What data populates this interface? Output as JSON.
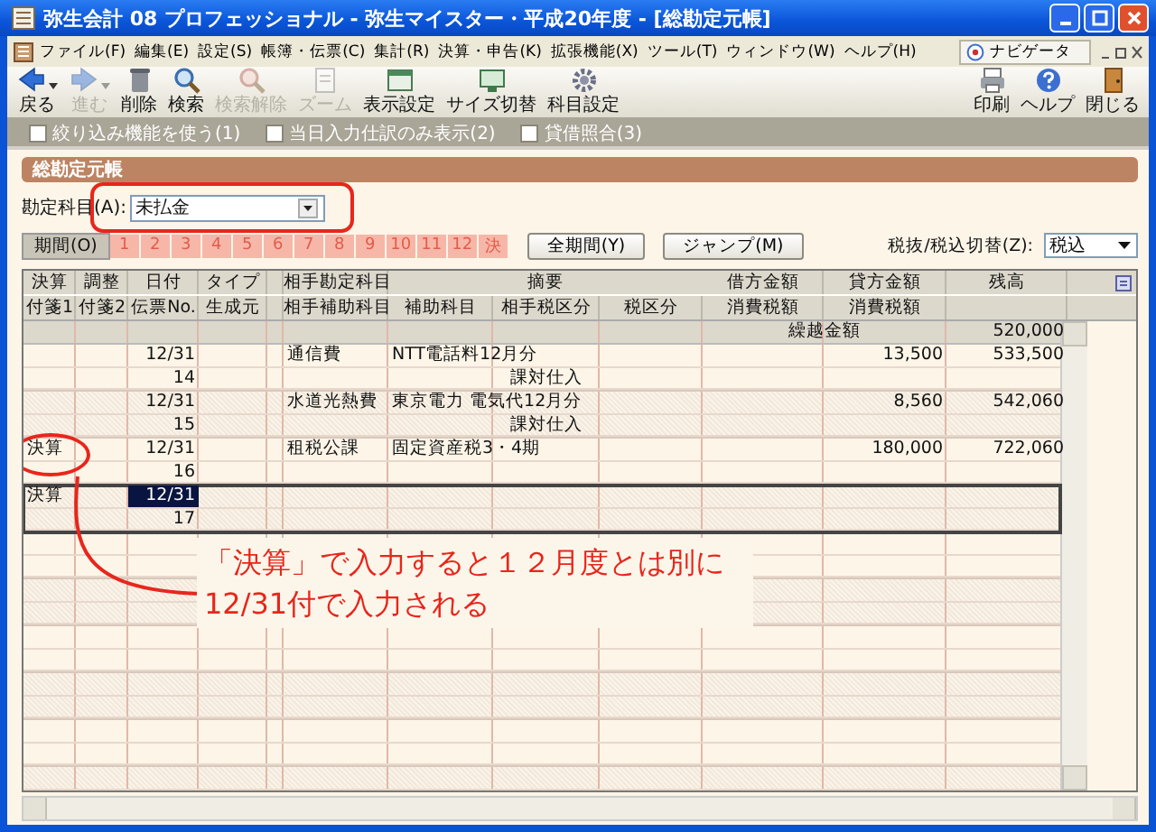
{
  "window": {
    "title": "弥生会計 08 プロフェッショナル - 弥生マイスター・平成20年度 - [総勘定元帳]"
  },
  "menu": {
    "items": [
      "ファイル(F)",
      "編集(E)",
      "設定(S)",
      "帳簿・伝票(C)",
      "集計(R)",
      "決算・申告(K)",
      "拡張機能(X)",
      "ツール(T)",
      "ウィンドウ(W)",
      "ヘルプ(H)"
    ],
    "navigator": "ナビゲータ"
  },
  "toolbar": {
    "left": [
      {
        "label": "戻る",
        "disabled": false,
        "dropdown": true
      },
      {
        "label": "進む",
        "disabled": true,
        "dropdown": true
      },
      {
        "label": "削除",
        "disabled": false,
        "dropdown": false
      },
      {
        "label": "検索",
        "disabled": false,
        "dropdown": false
      },
      {
        "label": "検索解除",
        "disabled": true,
        "dropdown": false
      },
      {
        "label": "ズーム",
        "disabled": true,
        "dropdown": false
      },
      {
        "label": "表示設定",
        "disabled": false,
        "dropdown": false
      },
      {
        "label": "サイズ切替",
        "disabled": false,
        "dropdown": false
      },
      {
        "label": "科目設定",
        "disabled": false,
        "dropdown": false
      }
    ],
    "right": [
      {
        "label": "印刷",
        "disabled": false
      },
      {
        "label": "ヘルプ",
        "disabled": false
      },
      {
        "label": "閉じる",
        "disabled": false
      }
    ]
  },
  "filters": [
    {
      "label": "絞り込み機能を使う(1)",
      "checked": false
    },
    {
      "label": "当日入力仕訳のみ表示(2)",
      "checked": false
    },
    {
      "label": "貸借照合(3)",
      "checked": false
    }
  ],
  "panel": {
    "title": "総勘定元帳",
    "account": {
      "label": "勘定科目(A):",
      "value": "未払金"
    },
    "periods": {
      "label": "期間(O)",
      "months": [
        {
          "label": "1",
          "selected": true
        },
        {
          "label": "2",
          "selected": true
        },
        {
          "label": "3",
          "selected": true
        },
        {
          "label": "4",
          "selected": true
        },
        {
          "label": "5",
          "selected": true
        },
        {
          "label": "6",
          "selected": true
        },
        {
          "label": "7",
          "selected": true
        },
        {
          "label": "8",
          "selected": true
        },
        {
          "label": "9",
          "selected": true
        },
        {
          "label": "10",
          "selected": true
        },
        {
          "label": "11",
          "selected": true
        },
        {
          "label": "12",
          "selected": true
        },
        {
          "label": "決",
          "selected": true
        }
      ]
    },
    "buttons": [
      "全期間(Y)",
      "ジャンプ(M)"
    ],
    "tax_mode": {
      "label": "税抜/税込切替(Z):",
      "value": "税込"
    }
  },
  "ledger": {
    "header_top": [
      "決算",
      "調整",
      "日付",
      "タイプ",
      "相手勘定科目",
      "摘要",
      "借方金額",
      "貸方金額",
      "残高"
    ],
    "header_bottom": [
      "付箋1",
      "付箋2",
      "伝票No.",
      "生成元",
      "相手補助科目",
      "補助科目",
      "相手税区分",
      "税区分",
      "消費税額",
      "消費税額"
    ],
    "carryover": {
      "label": "繰越金額",
      "balance": "520,000"
    },
    "entries": [
      {
        "date": "12/31",
        "slip_no": "14",
        "account": "通信費",
        "memo": "NTT電話料12月分",
        "counter_tax": "課対仕入",
        "credit": "13,500",
        "balance": "533,500",
        "selected": false
      },
      {
        "date": "12/31",
        "slip_no": "15",
        "account": "水道光熱費",
        "memo": "東京電力 電気代12月分",
        "counter_tax": "課対仕入",
        "credit": "8,560",
        "balance": "542,060",
        "selected": false
      },
      {
        "closing": "決算",
        "date": "12/31",
        "slip_no": "16",
        "account": "租税公課",
        "memo": "固定資産税3・4期",
        "credit": "180,000",
        "balance": "722,060",
        "selected": false
      },
      {
        "closing": "決算",
        "date": "12/31",
        "slip_no": "17",
        "selected": true
      }
    ]
  },
  "annotation": {
    "lines": [
      "「決算」で入力すると１２月度とは別に",
      "12/31付で入力される"
    ]
  }
}
